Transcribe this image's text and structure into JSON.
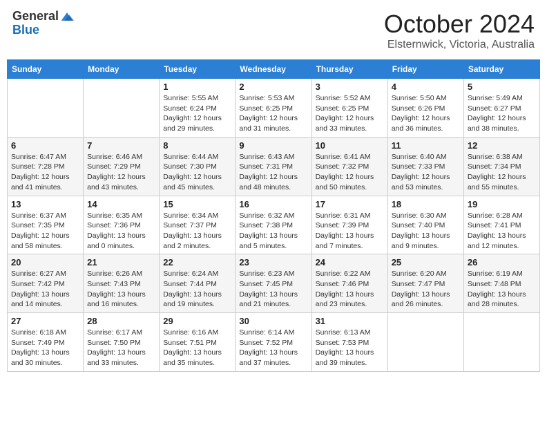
{
  "header": {
    "logo_general": "General",
    "logo_blue": "Blue",
    "month_title": "October 2024",
    "location": "Elsternwick, Victoria, Australia"
  },
  "days_of_week": [
    "Sunday",
    "Monday",
    "Tuesday",
    "Wednesday",
    "Thursday",
    "Friday",
    "Saturday"
  ],
  "weeks": [
    [
      {
        "day": "",
        "info": ""
      },
      {
        "day": "",
        "info": ""
      },
      {
        "day": "1",
        "info": "Sunrise: 5:55 AM\nSunset: 6:24 PM\nDaylight: 12 hours and 29 minutes."
      },
      {
        "day": "2",
        "info": "Sunrise: 5:53 AM\nSunset: 6:25 PM\nDaylight: 12 hours and 31 minutes."
      },
      {
        "day": "3",
        "info": "Sunrise: 5:52 AM\nSunset: 6:25 PM\nDaylight: 12 hours and 33 minutes."
      },
      {
        "day": "4",
        "info": "Sunrise: 5:50 AM\nSunset: 6:26 PM\nDaylight: 12 hours and 36 minutes."
      },
      {
        "day": "5",
        "info": "Sunrise: 5:49 AM\nSunset: 6:27 PM\nDaylight: 12 hours and 38 minutes."
      }
    ],
    [
      {
        "day": "6",
        "info": "Sunrise: 6:47 AM\nSunset: 7:28 PM\nDaylight: 12 hours and 41 minutes."
      },
      {
        "day": "7",
        "info": "Sunrise: 6:46 AM\nSunset: 7:29 PM\nDaylight: 12 hours and 43 minutes."
      },
      {
        "day": "8",
        "info": "Sunrise: 6:44 AM\nSunset: 7:30 PM\nDaylight: 12 hours and 45 minutes."
      },
      {
        "day": "9",
        "info": "Sunrise: 6:43 AM\nSunset: 7:31 PM\nDaylight: 12 hours and 48 minutes."
      },
      {
        "day": "10",
        "info": "Sunrise: 6:41 AM\nSunset: 7:32 PM\nDaylight: 12 hours and 50 minutes."
      },
      {
        "day": "11",
        "info": "Sunrise: 6:40 AM\nSunset: 7:33 PM\nDaylight: 12 hours and 53 minutes."
      },
      {
        "day": "12",
        "info": "Sunrise: 6:38 AM\nSunset: 7:34 PM\nDaylight: 12 hours and 55 minutes."
      }
    ],
    [
      {
        "day": "13",
        "info": "Sunrise: 6:37 AM\nSunset: 7:35 PM\nDaylight: 12 hours and 58 minutes."
      },
      {
        "day": "14",
        "info": "Sunrise: 6:35 AM\nSunset: 7:36 PM\nDaylight: 13 hours and 0 minutes."
      },
      {
        "day": "15",
        "info": "Sunrise: 6:34 AM\nSunset: 7:37 PM\nDaylight: 13 hours and 2 minutes."
      },
      {
        "day": "16",
        "info": "Sunrise: 6:32 AM\nSunset: 7:38 PM\nDaylight: 13 hours and 5 minutes."
      },
      {
        "day": "17",
        "info": "Sunrise: 6:31 AM\nSunset: 7:39 PM\nDaylight: 13 hours and 7 minutes."
      },
      {
        "day": "18",
        "info": "Sunrise: 6:30 AM\nSunset: 7:40 PM\nDaylight: 13 hours and 9 minutes."
      },
      {
        "day": "19",
        "info": "Sunrise: 6:28 AM\nSunset: 7:41 PM\nDaylight: 13 hours and 12 minutes."
      }
    ],
    [
      {
        "day": "20",
        "info": "Sunrise: 6:27 AM\nSunset: 7:42 PM\nDaylight: 13 hours and 14 minutes."
      },
      {
        "day": "21",
        "info": "Sunrise: 6:26 AM\nSunset: 7:43 PM\nDaylight: 13 hours and 16 minutes."
      },
      {
        "day": "22",
        "info": "Sunrise: 6:24 AM\nSunset: 7:44 PM\nDaylight: 13 hours and 19 minutes."
      },
      {
        "day": "23",
        "info": "Sunrise: 6:23 AM\nSunset: 7:45 PM\nDaylight: 13 hours and 21 minutes."
      },
      {
        "day": "24",
        "info": "Sunrise: 6:22 AM\nSunset: 7:46 PM\nDaylight: 13 hours and 23 minutes."
      },
      {
        "day": "25",
        "info": "Sunrise: 6:20 AM\nSunset: 7:47 PM\nDaylight: 13 hours and 26 minutes."
      },
      {
        "day": "26",
        "info": "Sunrise: 6:19 AM\nSunset: 7:48 PM\nDaylight: 13 hours and 28 minutes."
      }
    ],
    [
      {
        "day": "27",
        "info": "Sunrise: 6:18 AM\nSunset: 7:49 PM\nDaylight: 13 hours and 30 minutes."
      },
      {
        "day": "28",
        "info": "Sunrise: 6:17 AM\nSunset: 7:50 PM\nDaylight: 13 hours and 33 minutes."
      },
      {
        "day": "29",
        "info": "Sunrise: 6:16 AM\nSunset: 7:51 PM\nDaylight: 13 hours and 35 minutes."
      },
      {
        "day": "30",
        "info": "Sunrise: 6:14 AM\nSunset: 7:52 PM\nDaylight: 13 hours and 37 minutes."
      },
      {
        "day": "31",
        "info": "Sunrise: 6:13 AM\nSunset: 7:53 PM\nDaylight: 13 hours and 39 minutes."
      },
      {
        "day": "",
        "info": ""
      },
      {
        "day": "",
        "info": ""
      }
    ]
  ]
}
